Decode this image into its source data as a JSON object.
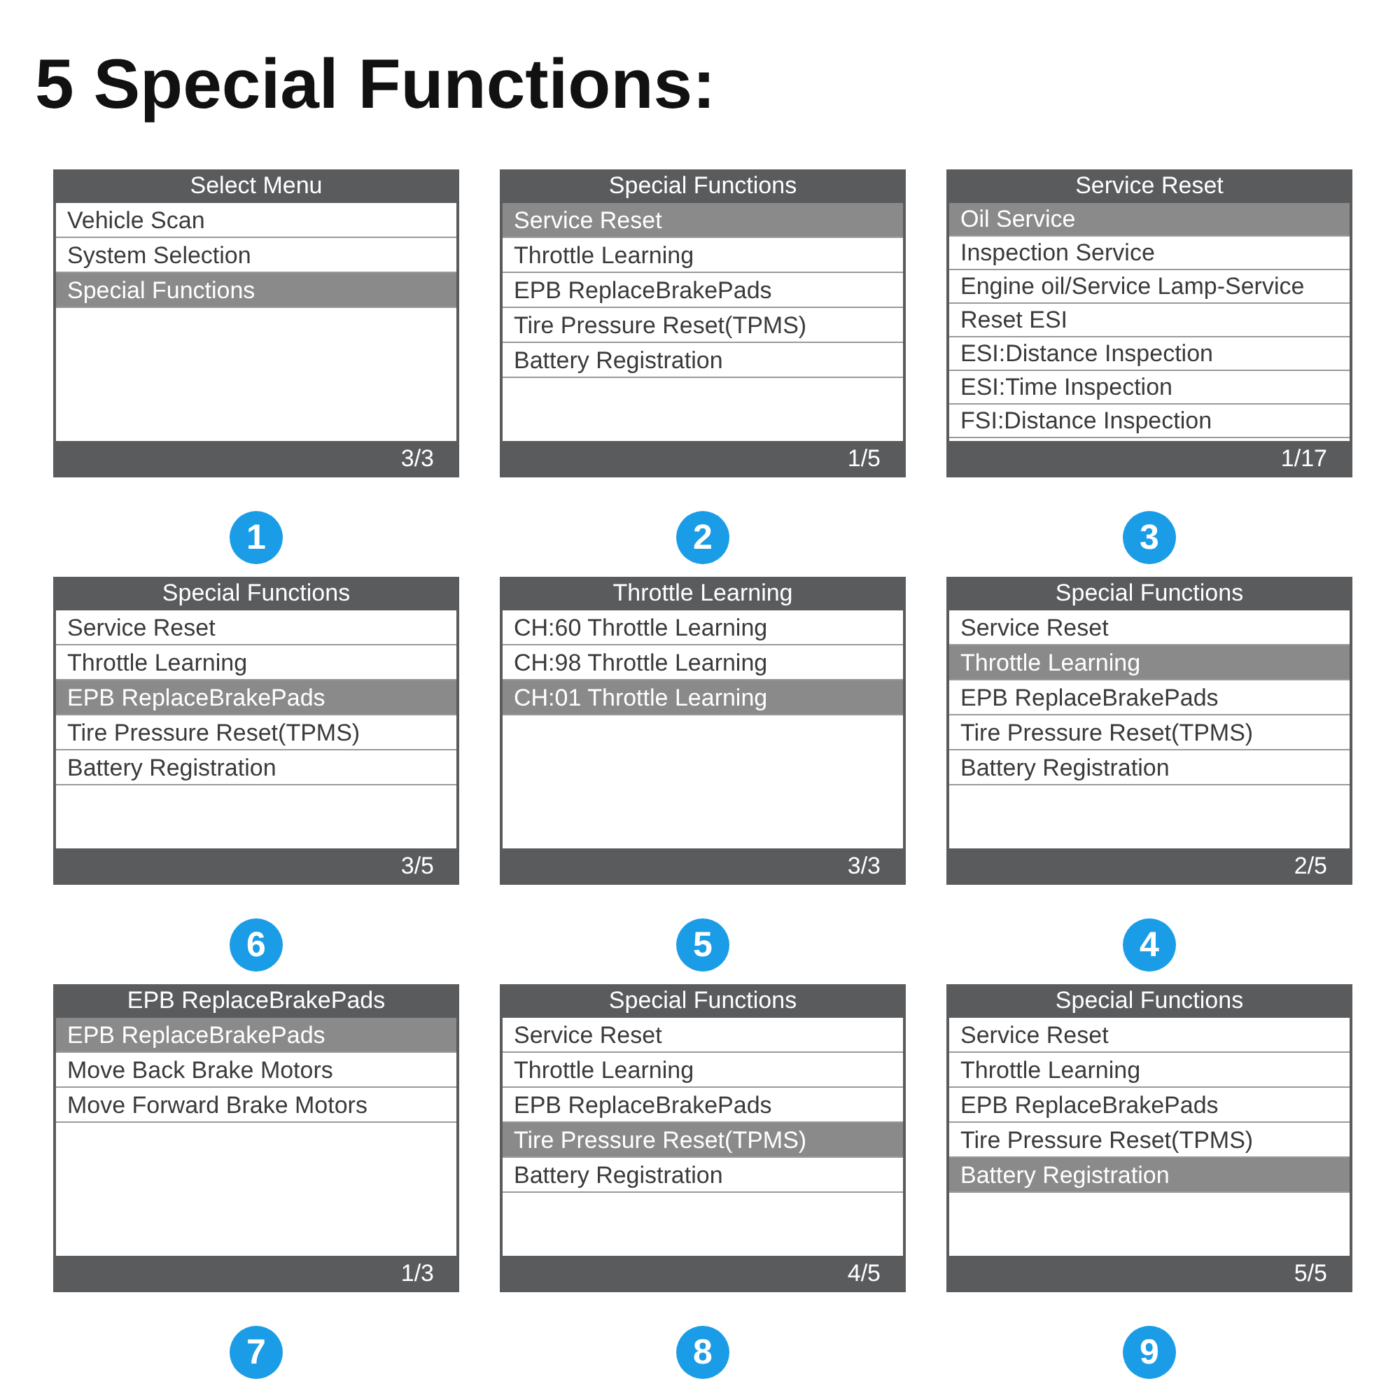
{
  "title": "5 Special Functions:",
  "screens": [
    {
      "number": "1",
      "title": "Select Menu",
      "page": "3/3",
      "items": [
        {
          "label": "Vehicle Scan",
          "selected": false
        },
        {
          "label": "System Selection",
          "selected": false
        },
        {
          "label": "Special Functions",
          "selected": true
        }
      ]
    },
    {
      "number": "2",
      "title": "Special Functions",
      "page": "1/5",
      "items": [
        {
          "label": "Service Reset",
          "selected": true
        },
        {
          "label": "Throttle Learning",
          "selected": false
        },
        {
          "label": "EPB ReplaceBrakePads",
          "selected": false
        },
        {
          "label": "Tire Pressure Reset(TPMS)",
          "selected": false
        },
        {
          "label": "Battery Registration",
          "selected": false
        }
      ]
    },
    {
      "number": "3",
      "title": "Service Reset",
      "page": "1/17",
      "items": [
        {
          "label": "Oil Service",
          "selected": true
        },
        {
          "label": "Inspection Service",
          "selected": false
        },
        {
          "label": "Engine oil/Service Lamp-Service",
          "selected": false
        },
        {
          "label": "Reset ESI",
          "selected": false
        },
        {
          "label": "ESI:Distance Inspection",
          "selected": false
        },
        {
          "label": "ESI:Time Inspection",
          "selected": false
        },
        {
          "label": "FSI:Distance Inspection",
          "selected": false
        }
      ]
    },
    {
      "number": "6",
      "title": "Special Functions",
      "page": "3/5",
      "items": [
        {
          "label": "Service Reset",
          "selected": false
        },
        {
          "label": "Throttle Learning",
          "selected": false
        },
        {
          "label": "EPB ReplaceBrakePads",
          "selected": true
        },
        {
          "label": "Tire Pressure Reset(TPMS)",
          "selected": false
        },
        {
          "label": "Battery Registration",
          "selected": false
        }
      ]
    },
    {
      "number": "5",
      "title": "Throttle Learning",
      "page": "3/3",
      "items": [
        {
          "label": "CH:60 Throttle Learning",
          "selected": false
        },
        {
          "label": "CH:98 Throttle Learning",
          "selected": false
        },
        {
          "label": "CH:01 Throttle Learning",
          "selected": true
        }
      ]
    },
    {
      "number": "4",
      "title": "Special Functions",
      "page": "2/5",
      "items": [
        {
          "label": "Service Reset",
          "selected": false
        },
        {
          "label": "Throttle Learning",
          "selected": true
        },
        {
          "label": "EPB ReplaceBrakePads",
          "selected": false
        },
        {
          "label": "Tire Pressure Reset(TPMS)",
          "selected": false
        },
        {
          "label": "Battery Registration",
          "selected": false
        }
      ]
    },
    {
      "number": "7",
      "title": "EPB ReplaceBrakePads",
      "page": "1/3",
      "items": [
        {
          "label": "EPB ReplaceBrakePads",
          "selected": true
        },
        {
          "label": "Move Back Brake Motors",
          "selected": false
        },
        {
          "label": "Move Forward Brake Motors",
          "selected": false
        }
      ]
    },
    {
      "number": "8",
      "title": "Special Functions",
      "page": "4/5",
      "items": [
        {
          "label": "Service Reset",
          "selected": false
        },
        {
          "label": "Throttle Learning",
          "selected": false
        },
        {
          "label": "EPB ReplaceBrakePads",
          "selected": false
        },
        {
          "label": "Tire Pressure Reset(TPMS)",
          "selected": true
        },
        {
          "label": "Battery Registration",
          "selected": false
        }
      ]
    },
    {
      "number": "9",
      "title": "Special Functions",
      "page": "5/5",
      "items": [
        {
          "label": "Service Reset",
          "selected": false
        },
        {
          "label": "Throttle Learning",
          "selected": false
        },
        {
          "label": "EPB ReplaceBrakePads",
          "selected": false
        },
        {
          "label": "Tire Pressure Reset(TPMS)",
          "selected": false
        },
        {
          "label": "Battery Registration",
          "selected": true
        }
      ]
    }
  ]
}
